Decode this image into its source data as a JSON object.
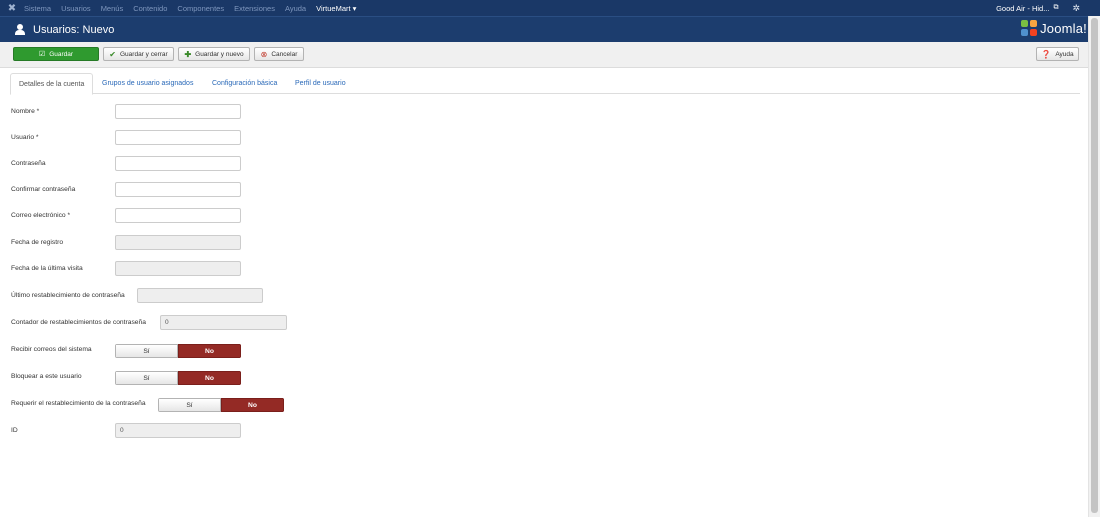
{
  "topbar": {
    "menu": [
      "Sistema",
      "Usuarios",
      "Menús",
      "Contenido",
      "Componentes",
      "Extensiones",
      "Ayuda"
    ],
    "virtuemart": "VirtueMart ▾",
    "site_name": "Good Air - Hid...",
    "external_icon": "external-link-icon",
    "settings_icon": "gear-icon"
  },
  "header": {
    "title": "Usuarios: Nuevo",
    "brand": "Joomla!"
  },
  "toolbar": {
    "save_label": "Guardar",
    "save_close_label": "Guardar y cerrar",
    "save_new_label": "Guardar y nuevo",
    "cancel_label": "Cancelar",
    "help_label": "Ayuda"
  },
  "tabs": [
    {
      "label": "Detalles de la cuenta",
      "active": true
    },
    {
      "label": "Grupos de usuario asignados",
      "active": false
    },
    {
      "label": "Configuración básica",
      "active": false
    },
    {
      "label": "Perfil de usuario",
      "active": false
    }
  ],
  "form": {
    "name_label": "Nombre *",
    "username_label": "Usuario *",
    "password_label": "Contraseña",
    "confirm_password_label": "Confirmar contraseña",
    "email_label": "Correo electrónico *",
    "register_date_label": "Fecha de registro",
    "last_visit_label": "Fecha de la última visita",
    "last_reset_label": "Último restablecimiento de contraseña",
    "reset_count_label": "Contador de restablecimientos de contraseña",
    "reset_count_value": "0",
    "send_email_label": "Recibir correos del sistema",
    "block_label": "Bloquear a este usuario",
    "require_reset_label": "Requerir el restablecimiento de la contraseña",
    "id_label": "ID",
    "id_value": "0",
    "yes_label": "Sí",
    "no_label": "No"
  },
  "colors": {
    "topbar": "#1a3867",
    "header": "#1c3d6e",
    "save_button": "#2f9a2f",
    "toggle_no": "#942a25",
    "link": "#2a69b8"
  }
}
